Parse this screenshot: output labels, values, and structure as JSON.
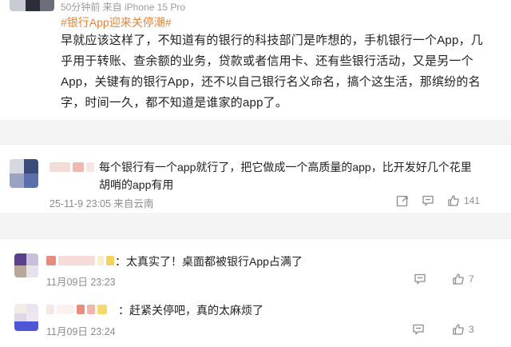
{
  "post": {
    "meta": "50分钟前  来自 iPhone 15 Pro",
    "topic": "#银行App迎来关停潮#",
    "text": "早就应该这样了，不知道有的银行的科技部门是咋想的，手机银行一个App，几乎用于转账、查余额的业务，贷款或者信用卡、还有些银行活动，又是另一个App，关键有的银行App，还不以自己银行名义命名，搞个这生活，那缤纷的名字，时间一久，都不知道是谁家的app了。"
  },
  "comments": [
    {
      "text": "每个银行有一个app就行了，把它做成一个高质量的app，比开发好几个花里胡哨的app有用",
      "time": "25-11-9 23:05 来自云南",
      "like_count": "141"
    }
  ],
  "replies": [
    {
      "text": "：太真实了！桌面都被银行App占满了",
      "time": "11月09日 23:23",
      "like_count": "7"
    },
    {
      "text": "：赶紧关停吧，真的太麻烦了",
      "time": "11月09日 23:24",
      "like_count": "3"
    }
  ],
  "colors": {
    "topic": "#e8833a",
    "secondary_text": "#8c8c8c",
    "divider": "#f4f4f4"
  },
  "icons": [
    "share-icon",
    "comment-icon",
    "like-icon"
  ]
}
